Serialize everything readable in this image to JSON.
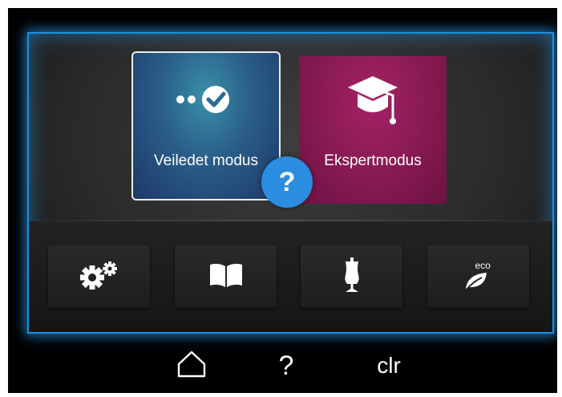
{
  "modes": {
    "guided_label": "Veiledet modus",
    "expert_label": "Ekspertmodus",
    "help_symbol": "?"
  },
  "function_bar": {
    "icons": [
      "settings-gears-icon",
      "book-icon",
      "dress-form-icon",
      "eco-leaf-icon"
    ],
    "eco_text": "eco"
  },
  "nav": {
    "home_icon": "home-icon",
    "help_label": "?",
    "clear_label": "clr"
  },
  "colors": {
    "accent_blue": "#1d8fe0",
    "guided_tile": "#2a5d88",
    "expert_tile": "#861a51",
    "help_bubble": "#2a8de0"
  }
}
